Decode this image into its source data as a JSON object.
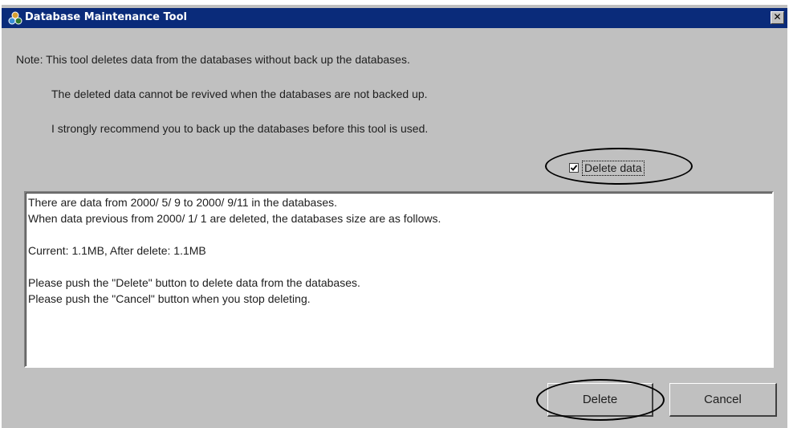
{
  "window": {
    "title": "Database Maintenance Tool",
    "close_glyph": "✕",
    "app_icon": "database-tool-icon"
  },
  "notes": [
    "Note: This tool deletes data from the databases without back up the databases.",
    "The deleted data cannot be revived when the databases are not backed up.",
    "I strongly recommend you to back up the databases before this tool is used."
  ],
  "delete_option": {
    "label": "Delete data",
    "checked": true
  },
  "message": {
    "lines": [
      "There are data from 2000/ 5/ 9 to 2000/ 9/11 in the databases.",
      "When data previous from 2000/ 1/ 1 are deleted, the databases size are as follows.",
      "",
      "Current:  1.1MB,   After delete:  1.1MB",
      "",
      "Please push the \"Delete\" button to delete data from the databases.",
      "Please push the \"Cancel\" button when you stop deleting."
    ]
  },
  "buttons": {
    "delete_label": "Delete",
    "cancel_label": "Cancel"
  },
  "colors": {
    "titlebar": "#0a2b7a",
    "window_bg": "#c0c0c0"
  }
}
